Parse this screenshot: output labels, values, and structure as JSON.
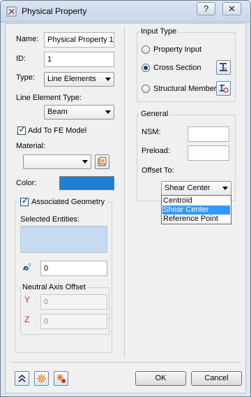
{
  "window": {
    "title": "Physical Property",
    "help_glyph": "?",
    "close_glyph": "✕"
  },
  "left": {
    "name_label": "Name:",
    "name_value": "Physical Property 1",
    "id_label": "ID:",
    "id_value": "1",
    "type_label": "Type:",
    "type_value": "Line Elements",
    "line_element_type_label": "Line Element Type:",
    "line_element_type_value": "Beam",
    "add_to_fe_label": "Add To FE Model",
    "add_to_fe_checked": true,
    "material_label": "Material:",
    "material_value": "",
    "color_label": "Color:",
    "color_value": "#1f80d2",
    "assoc_geom_label": "Associated Geometry",
    "assoc_geom_checked": true,
    "selected_entities_label": "Selected Entities:",
    "count_value": "0",
    "neutral_axis_label": "Neutral Axis Offset",
    "y_label": "Y",
    "y_value": "0",
    "z_label": "Z",
    "z_value": "0"
  },
  "input_type": {
    "label": "Input Type",
    "options": [
      "Property Input",
      "Cross Section",
      "Structural Member"
    ],
    "selected": "Cross Section"
  },
  "general": {
    "label": "General",
    "nsm_label": "NSM:",
    "nsm_value": "",
    "preload_label": "Preload:",
    "preload_value": "",
    "offset_to_label": "Offset To:",
    "offset_to_value": "Shear Center",
    "offset_options": [
      "Centroid",
      "Shear Center",
      "Reference Point"
    ],
    "highlighted_option": "Shear Center"
  },
  "footer": {
    "ok_label": "OK",
    "cancel_label": "Cancel"
  }
}
